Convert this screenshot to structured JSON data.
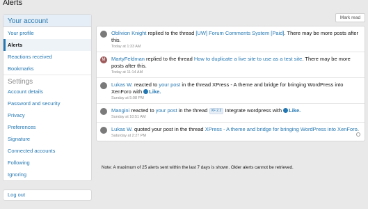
{
  "page_title": "Alerts",
  "sidebar": {
    "account_header": "Your account",
    "items": [
      {
        "label": "Your profile"
      },
      {
        "label": "Alerts"
      },
      {
        "label": "Reactions received"
      },
      {
        "label": "Bookmarks"
      }
    ],
    "settings_header": "Settings",
    "settings_items": [
      {
        "label": "Account details"
      },
      {
        "label": "Password and security"
      },
      {
        "label": "Privacy"
      },
      {
        "label": "Preferences"
      },
      {
        "label": "Signature"
      },
      {
        "label": "Connected accounts"
      },
      {
        "label": "Following"
      },
      {
        "label": "Ignoring"
      }
    ],
    "logout": "Log out"
  },
  "toolbar": {
    "mark_read": "Mark read"
  },
  "alerts": [
    {
      "user": "Oblivion Knight",
      "mid": " replied to the thread ",
      "thread": "[UW] Forum Comments System [Paid]",
      "tail": ". There may be more posts after this.",
      "time": "Today at 1:33 AM"
    },
    {
      "avatar_letter": "M",
      "user": "MartyFeldman",
      "mid": " replied to the thread ",
      "thread": "How to duplicate a live site to use as a test site",
      "tail": ". There may be more posts after this.",
      "time": "Today at 11:14 AM"
    },
    {
      "user": "Lukas W.",
      "mid": " reacted to ",
      "post": "your post",
      "mid2": " in the thread XPress - A theme and bridge for bringing WordPress into XenForo with ",
      "like": "Like.",
      "time": "Sunday at 5:08 PM"
    },
    {
      "user": "Mangini",
      "mid": " reacted to ",
      "post": "your post",
      "mid2": " in the thread ",
      "badge": "XF 2.2",
      "mid3": " Integrate wordpress with ",
      "like": "Like.",
      "time": "Sunday at 10:51 AM"
    },
    {
      "user": "Lukas W.",
      "mid": " quoted your post in the thread ",
      "thread": "XPress - A theme and bridge for bringing WordPress into XenForo",
      "tail": ".",
      "time": "Saturday at 2:27 PM"
    }
  ],
  "note": "Note:  A maximum of 25 alerts sent within the last 7 days is shown.  Older alerts cannot be retrieved."
}
